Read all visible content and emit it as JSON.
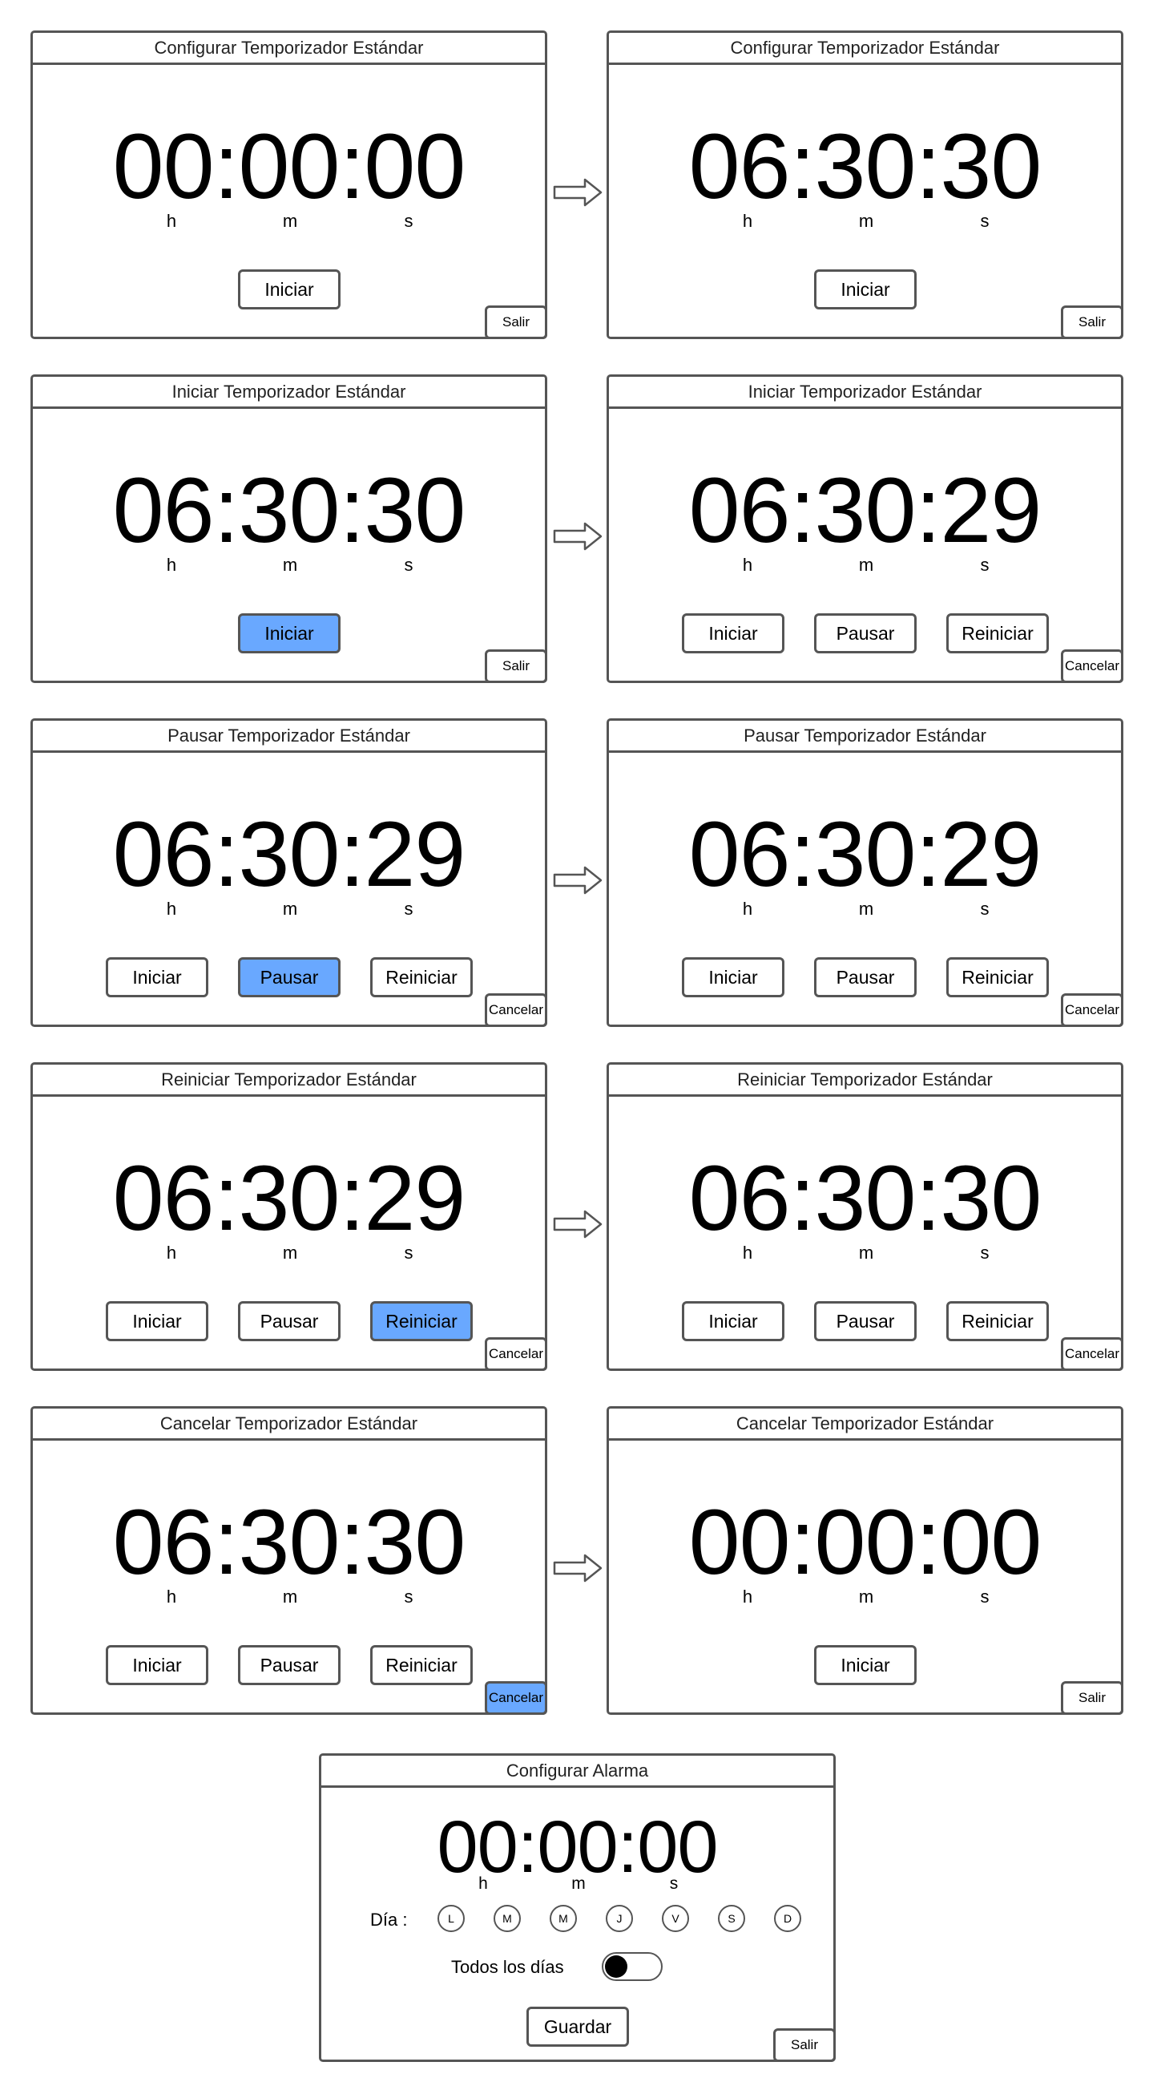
{
  "screens": [
    {
      "title": "Configurar Temporizador Estándar",
      "time": "00:00:00",
      "buttons": [
        "Iniciar"
      ],
      "active_button": "",
      "corner": "Salir",
      "corner_active": false
    },
    {
      "title": "Configurar Temporizador Estándar",
      "time": "06:30:30",
      "buttons": [
        "Iniciar"
      ],
      "active_button": "",
      "corner": "Salir",
      "corner_active": false
    },
    {
      "title": "Iniciar Temporizador Estándar",
      "time": "06:30:30",
      "buttons": [
        "Iniciar"
      ],
      "active_button": "Iniciar",
      "corner": "Salir",
      "corner_active": false
    },
    {
      "title": "Iniciar Temporizador Estándar",
      "time": "06:30:29",
      "buttons": [
        "Iniciar",
        "Pausar",
        "Reiniciar"
      ],
      "active_button": "",
      "corner": "Cancelar",
      "corner_active": false
    },
    {
      "title": "Pausar Temporizador Estándar",
      "time": "06:30:29",
      "buttons": [
        "Iniciar",
        "Pausar",
        "Reiniciar"
      ],
      "active_button": "Pausar",
      "corner": "Cancelar",
      "corner_active": false
    },
    {
      "title": "Pausar Temporizador Estándar",
      "time": "06:30:29",
      "buttons": [
        "Iniciar",
        "Pausar",
        "Reiniciar"
      ],
      "active_button": "",
      "corner": "Cancelar",
      "corner_active": false
    },
    {
      "title": "Reiniciar Temporizador Estándar",
      "time": "06:30:29",
      "buttons": [
        "Iniciar",
        "Pausar",
        "Reiniciar"
      ],
      "active_button": "Reiniciar",
      "corner": "Cancelar",
      "corner_active": false
    },
    {
      "title": "Reiniciar Temporizador Estándar",
      "time": "06:30:30",
      "buttons": [
        "Iniciar",
        "Pausar",
        "Reiniciar"
      ],
      "active_button": "",
      "corner": "Cancelar",
      "corner_active": false
    },
    {
      "title": "Cancelar Temporizador Estándar",
      "time": "06:30:30",
      "buttons": [
        "Iniciar",
        "Pausar",
        "Reiniciar"
      ],
      "active_button": "",
      "corner": "Cancelar",
      "corner_active": true
    },
    {
      "title": "Cancelar Temporizador Estándar",
      "time": "00:00:00",
      "buttons": [
        "Iniciar"
      ],
      "active_button": "",
      "corner": "Salir",
      "corner_active": false
    }
  ],
  "units": {
    "h": "h",
    "m": "m",
    "s": "s"
  },
  "arrow_icon": "right-arrow-icon",
  "colors": {
    "active": "#69a8ff",
    "border": "#555555"
  },
  "alarm": {
    "title": "Configurar Alarma",
    "time": "00:00:00",
    "dia_label": "Día :",
    "days": [
      "L",
      "M",
      "M",
      "J",
      "V",
      "S",
      "D"
    ],
    "todos_label": "Todos los días",
    "toggle_on": false,
    "save_label": "Guardar",
    "exit_label": "Salir"
  }
}
